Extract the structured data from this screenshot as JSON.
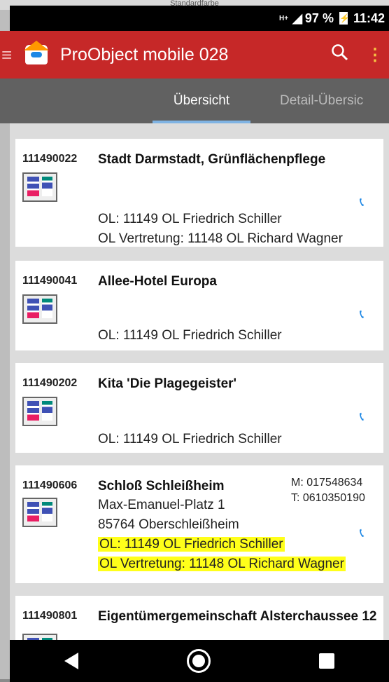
{
  "status": {
    "network": "H+",
    "battery": "97 %",
    "time": "11:42"
  },
  "ghost_top": "Standardfarbe",
  "app": {
    "title": "ProObject mobile 028"
  },
  "tabs": [
    {
      "label": "Übersicht",
      "active": true
    },
    {
      "label": "Detail-Übersic",
      "active": false
    }
  ],
  "objects": [
    {
      "number": "111490022",
      "name": "Stadt Darmstadt, Grünflächenpflege",
      "lines": [
        "OL: 11149 OL Friedrich Schiller",
        "OL Vertretung: 11148 OL Richard  Wagner"
      ]
    },
    {
      "number": "111490041",
      "name": "Allee-Hotel Europa",
      "lines": [
        "OL: 11149 OL Friedrich Schiller"
      ]
    },
    {
      "number": "111490202",
      "name": "Kita 'Die Plagegeister'",
      "lines": [
        "OL: 11149 OL Friedrich Schiller"
      ]
    },
    {
      "number": "111490606",
      "name": "Schloß Schleißheim",
      "address": [
        "Max-Emanuel-Platz 1",
        "85764 Oberschleißheim"
      ],
      "contact": [
        "M: 017548634",
        "T: 0610350190"
      ],
      "lines": [
        "OL: 11149 OL Friedrich Schiller",
        "OL Vertretung: 11148 OL Richard  Wagner"
      ]
    },
    {
      "number": "111490801",
      "name": "Eigentümergemeinschaft Alsterchaussee 12",
      "lines": []
    }
  ],
  "icons": {
    "menu": "menu-icon",
    "logo": "app-logo-icon",
    "search": "search-icon",
    "more": "more-vert-icon",
    "phone": "phone-icon",
    "object": "object-thumbnail-icon",
    "back": "back-nav-icon",
    "home": "home-nav-icon",
    "recents": "recents-nav-icon"
  },
  "colors": {
    "appbar": "#c62828",
    "tabbar": "#616161",
    "tab_indicator": "#7fb3e3",
    "phone": "#1e88e5",
    "highlight": "#ffff1a"
  }
}
